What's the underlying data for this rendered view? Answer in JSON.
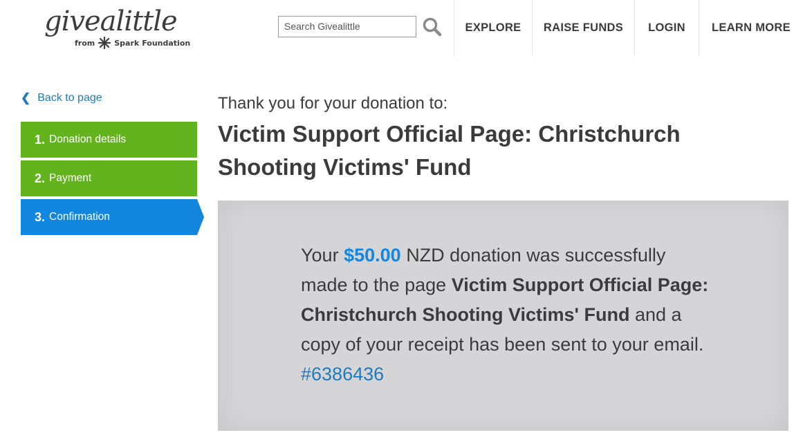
{
  "header": {
    "logo": {
      "wordmark": "givealittle",
      "from": "from",
      "brand": "Spark",
      "brand_suffix": "Foundation"
    },
    "search": {
      "placeholder": "Search Givealittle"
    },
    "nav": [
      "EXPLORE",
      "RAISE FUNDS",
      "LOGIN",
      "LEARN MORE"
    ]
  },
  "sidebar": {
    "back_label": "Back to page",
    "steps": [
      {
        "num": "1.",
        "label": "Donation details",
        "state": "complete"
      },
      {
        "num": "2.",
        "label": "Payment",
        "state": "complete"
      },
      {
        "num": "3.",
        "label": "Confirmation",
        "state": "active"
      }
    ]
  },
  "main": {
    "thanks": "Thank you for your donation to:",
    "page_title": "Victim Support Official Page: Christchurch Shooting Victims' Fund",
    "confirmation": {
      "prefix": "Your",
      "amount": "$50.00",
      "mid": "NZD donation was successfully made to the page",
      "page_name": "Victim Support Official Page: Christchurch Shooting Victims' Fund",
      "suffix": "and a copy of your receipt has been sent to your email.",
      "reference": "#6386436"
    }
  },
  "colors": {
    "green": "#63b31e",
    "blue": "#1387de",
    "link": "#1f7bb8",
    "panel": "#d5d5d8",
    "text": "#3b3b3d"
  }
}
